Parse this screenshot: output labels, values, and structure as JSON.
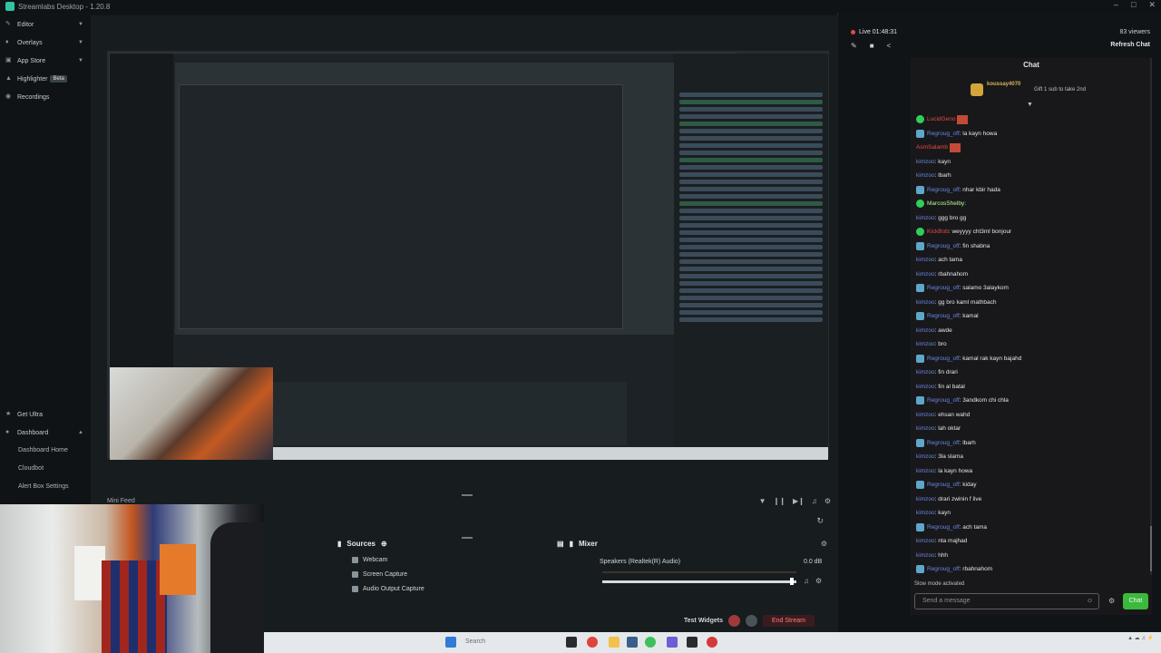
{
  "window": {
    "title": "Streamlabs Desktop - 1.20.8"
  },
  "sidebar": {
    "items": [
      {
        "label": "Editor",
        "icon": "pencil-icon"
      },
      {
        "label": "Overlays",
        "icon": "layers-icon"
      },
      {
        "label": "App Store",
        "icon": "store-icon"
      },
      {
        "label": "Highlighter",
        "badge": "Beta",
        "icon": "highlighter-icon"
      },
      {
        "label": "Recordings",
        "icon": "record-icon"
      }
    ],
    "bottom": {
      "get_ultra": "Get Ultra",
      "dashboard": "Dashboard",
      "dashboard_home": "Dashboard Home",
      "cloudbot": "Cloudbot",
      "alert_box": "Alert Box Settings"
    }
  },
  "minifeed": {
    "title": "Mini Feed"
  },
  "sources": {
    "title": "Sources",
    "items": [
      "Webcam",
      "Screen Capture",
      "Audio Output Capture"
    ]
  },
  "mixer": {
    "title": "Mixer",
    "device": "Speakers (Realtek(R) Audio)",
    "db": "0.0 dB"
  },
  "footer": {
    "test_widgets": "Test Widgets",
    "end_stream": "End Stream"
  },
  "live": {
    "label": "Live 01:48:31",
    "viewers": "83 viewers",
    "refresh": "Refresh Chat"
  },
  "chat": {
    "title": "Chat",
    "pinned_user": "koussay4070",
    "pinned_text": "Gift 1 sub to take 2nd",
    "messages": [
      {
        "user": "LucidGeno",
        "text": "",
        "badge": "vip",
        "ucolor": "red",
        "emote": true
      },
      {
        "user": "Regroug_off",
        "text": ": la kayn howa",
        "badge": "mod",
        "ucolor": "blue"
      },
      {
        "user": "AsmSalamb",
        "text": "",
        "badge": "",
        "ucolor": "red",
        "emote": true
      },
      {
        "user": "kimzoo",
        "text": ": kayn",
        "badge": "",
        "ucolor": "blue"
      },
      {
        "user": "kimzoo",
        "text": ": lbarh",
        "badge": "",
        "ucolor": "blue"
      },
      {
        "user": "Regroug_off",
        "text": ": nhar kbir hada",
        "badge": "mod",
        "ucolor": "blue"
      },
      {
        "user": "MarcosShelby",
        "text": ":",
        "badge": "vip",
        "ucolor": "lime"
      },
      {
        "user": "kimzoo",
        "text": ": ggg bro gg",
        "badge": "",
        "ucolor": "blue"
      },
      {
        "user": "KickBob",
        "text": ": weyyyy cht3ml bonjour",
        "badge": "vip",
        "ucolor": "red"
      },
      {
        "user": "Regroug_off",
        "text": ": fin shabna",
        "badge": "mod",
        "ucolor": "blue"
      },
      {
        "user": "kimzoo",
        "text": ": ach tama",
        "badge": "",
        "ucolor": "blue"
      },
      {
        "user": "kimzoo",
        "text": ": rbahnahom",
        "badge": "",
        "ucolor": "blue"
      },
      {
        "user": "Regroug_off",
        "text": ": salamo 3alaykom",
        "badge": "mod",
        "ucolor": "blue"
      },
      {
        "user": "kimzoo",
        "text": ": gg bro kaml mathbach",
        "badge": "",
        "ucolor": "blue"
      },
      {
        "user": "Regroug_off",
        "text": ": kamal",
        "badge": "mod",
        "ucolor": "blue"
      },
      {
        "user": "kimzoo",
        "text": ": awde",
        "badge": "",
        "ucolor": "blue"
      },
      {
        "user": "kimzoo",
        "text": ": bro",
        "badge": "",
        "ucolor": "blue"
      },
      {
        "user": "Regroug_off",
        "text": ": kamal rak kayn bajahd",
        "badge": "mod",
        "ucolor": "blue"
      },
      {
        "user": "kimzoo",
        "text": ": fin drari",
        "badge": "",
        "ucolor": "blue"
      },
      {
        "user": "kimzoo",
        "text": ": fin al batal",
        "badge": "",
        "ucolor": "blue"
      },
      {
        "user": "Regroug_off",
        "text": ": 3andkom chi chla",
        "badge": "mod",
        "ucolor": "blue"
      },
      {
        "user": "kimzoo",
        "text": ": ehsan wahd",
        "badge": "",
        "ucolor": "blue"
      },
      {
        "user": "kimzoo",
        "text": ": lah oktar",
        "badge": "",
        "ucolor": "blue"
      },
      {
        "user": "Regroug_off",
        "text": ": lbarh",
        "badge": "mod",
        "ucolor": "blue"
      },
      {
        "user": "kimzoo",
        "text": ": 3la slama",
        "badge": "",
        "ucolor": "blue"
      },
      {
        "user": "kimzoo",
        "text": ": la kayn howa",
        "badge": "",
        "ucolor": "blue"
      },
      {
        "user": "Regroug_off",
        "text": ": kiday",
        "badge": "mod",
        "ucolor": "blue"
      },
      {
        "user": "kimzoo",
        "text": ": drari zwinin f live",
        "badge": "",
        "ucolor": "blue"
      },
      {
        "user": "kimzoo",
        "text": ": kayn",
        "badge": "",
        "ucolor": "blue"
      },
      {
        "user": "Regroug_off",
        "text": ": ach tama",
        "badge": "mod",
        "ucolor": "blue"
      },
      {
        "user": "kimzoo",
        "text": ": nta majhad",
        "badge": "",
        "ucolor": "blue"
      },
      {
        "user": "kimzoo",
        "text": ": hhh",
        "badge": "",
        "ucolor": "blue"
      },
      {
        "user": "Regroug_off",
        "text": ": rbahnahom",
        "badge": "mod",
        "ucolor": "blue"
      }
    ],
    "slow_mode": "Slow mode activated",
    "input_placeholder": "Send a message",
    "send": "Chat"
  },
  "taskbar": {
    "search": "Search"
  },
  "colors": {
    "accent": "#31c3a2",
    "live": "#e04b4b",
    "chat_button": "#3cb93c"
  }
}
